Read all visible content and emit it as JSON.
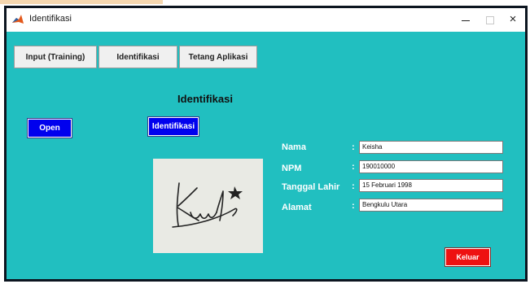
{
  "window": {
    "title": "Identifikasi",
    "controls": {
      "minimize": "minimize-icon",
      "maximize": "maximize-icon",
      "close": "×"
    }
  },
  "tabs": [
    {
      "label": "Input (Training)"
    },
    {
      "label": "Identifikasi"
    },
    {
      "label": "Tetang Aplikasi"
    }
  ],
  "main": {
    "heading": "Identifikasi",
    "open_button": "Open",
    "identify_button": "Identifikasi",
    "exit_button": "Keluar"
  },
  "fields": [
    {
      "label": "Nama",
      "value": "Keisha"
    },
    {
      "label": "NPM",
      "value": "190010000"
    },
    {
      "label": "Tanggal Lahir",
      "value": "15 Februari 1998"
    },
    {
      "label": "Alamat",
      "value": "Bengkulu Utara"
    }
  ],
  "colors": {
    "background": "#21bfc0",
    "button_blue": "#0000ee",
    "button_red": "#ee1111",
    "signature_bg": "#e9eae4"
  }
}
